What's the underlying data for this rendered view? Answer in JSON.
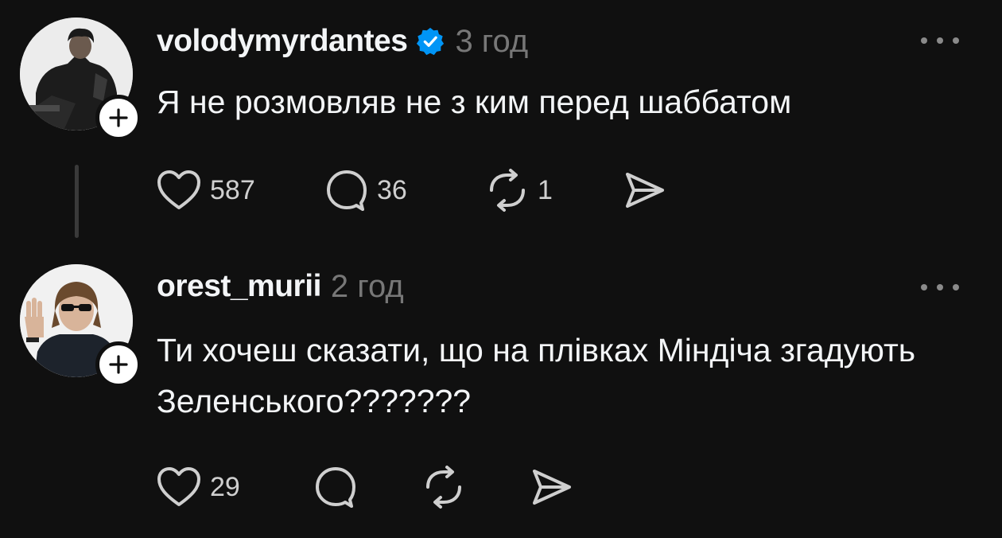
{
  "posts": [
    {
      "username": "volodymyrdantes",
      "verified": true,
      "time": "3 год",
      "text": "Я не розмовляв не з ким перед шаббатом",
      "likes": "587",
      "replies": "36",
      "reposts": "1"
    },
    {
      "username": "orest_murii",
      "verified": false,
      "time": "2 год",
      "text": "Ти хочеш сказати, що на плівках Міндіча згадують Зеленського???????",
      "likes": "29",
      "replies": "",
      "reposts": ""
    }
  ],
  "colors": {
    "background": "#101010",
    "text": "#f3f5f7",
    "muted": "#777777",
    "verified_blue": "#0095f6"
  },
  "icons": [
    "follow-plus-icon",
    "verified-badge-icon",
    "more-icon",
    "heart-icon",
    "comment-icon",
    "repost-icon",
    "share-icon"
  ]
}
